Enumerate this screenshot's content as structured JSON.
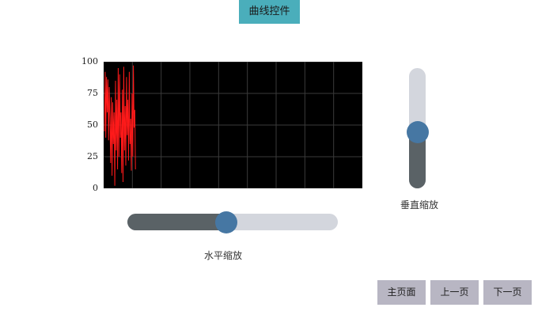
{
  "header": {
    "title": "曲线控件"
  },
  "colors": {
    "title_bg": "#4aaebb",
    "plot_bg": "#000000",
    "curve": "#ff1a1a",
    "grid": "#3a3a3a",
    "slider_fill": "#5a6266",
    "slider_track": "#d3d6dd",
    "slider_thumb": "#4677a3",
    "nav_button_bg": "#b8b6c3"
  },
  "chart_data": {
    "type": "line",
    "ylim": [
      0,
      100
    ],
    "y_ticks": [
      "100",
      "75",
      "50",
      "25",
      "0"
    ],
    "grid": true,
    "x_gridlines": 9,
    "series": [
      {
        "color": "#ff1a1a",
        "values": [
          45,
          92,
          40,
          88,
          60,
          86,
          38,
          80,
          55,
          20,
          72,
          10,
          68,
          35,
          60,
          2,
          85,
          30,
          70,
          15,
          95,
          25,
          90,
          40,
          60,
          12,
          78,
          5,
          96,
          30,
          65,
          18,
          88,
          42,
          70,
          22,
          92,
          35,
          55,
          14,
          75,
          25,
          97,
          48,
          62,
          15
        ]
      }
    ]
  },
  "horizontal_zoom": {
    "label": "水平缩放",
    "value": 0.47
  },
  "vertical_zoom": {
    "label": "垂直缩放",
    "value": 0.47
  },
  "nav": {
    "home": "主页面",
    "prev": "上一页",
    "next": "下一页"
  }
}
